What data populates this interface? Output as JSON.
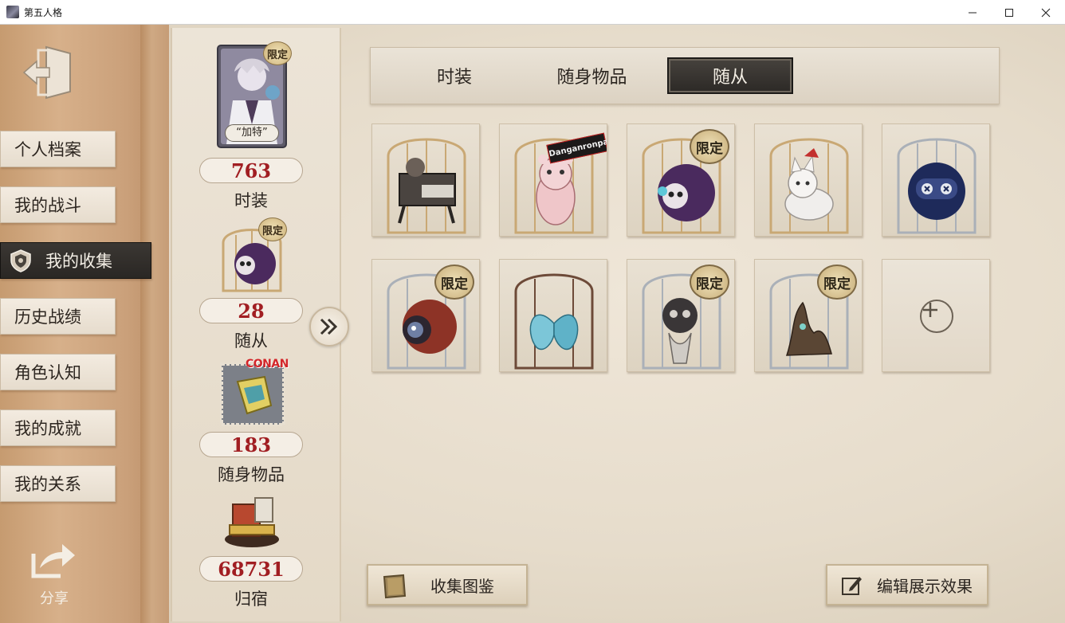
{
  "window": {
    "title": "第五人格"
  },
  "sidebar": {
    "items": [
      {
        "label": "个人档案",
        "active": false
      },
      {
        "label": "我的战斗",
        "active": false
      },
      {
        "label": "我的收集",
        "active": true
      },
      {
        "label": "历史战绩",
        "active": false
      },
      {
        "label": "角色认知",
        "active": false
      },
      {
        "label": "我的成就",
        "active": false
      },
      {
        "label": "我的关系",
        "active": false
      }
    ],
    "share_label": "分享"
  },
  "stats": {
    "costume": {
      "badge": "限定",
      "card_name": "“加特”",
      "value": "763",
      "label": "时装"
    },
    "companion": {
      "badge": "限定",
      "value": "28",
      "label": "随从"
    },
    "accessory": {
      "badge": "CONAN",
      "value": "183",
      "label": "随身物品"
    },
    "home": {
      "value": "68731",
      "label": "归宿"
    }
  },
  "tabs": [
    {
      "label": "时装",
      "active": false
    },
    {
      "label": "随身物品",
      "active": false
    },
    {
      "label": "随从",
      "active": true
    }
  ],
  "companions": [
    {
      "icon": "mechanical-beetle-companion",
      "limited": false,
      "badge": ""
    },
    {
      "icon": "danganronpa-bear-companion",
      "limited": false,
      "badge": "Danganronpa"
    },
    {
      "icon": "purple-sheep-companion",
      "limited": true,
      "badge": "限定"
    },
    {
      "icon": "white-fox-companion",
      "limited": false,
      "badge": ""
    },
    {
      "icon": "blue-robot-ball-companion",
      "limited": false,
      "badge": ""
    },
    {
      "icon": "red-eyeball-companion",
      "limited": true,
      "badge": "限定"
    },
    {
      "icon": "blue-butterfly-companion",
      "limited": false,
      "badge": ""
    },
    {
      "icon": "skull-creature-companion",
      "limited": true,
      "badge": "限定"
    },
    {
      "icon": "wooden-creature-companion",
      "limited": true,
      "badge": "限定"
    },
    {
      "icon": "add-icon",
      "limited": false,
      "badge": ""
    }
  ],
  "buttons": {
    "gallery": "收集图鉴",
    "edit_display": "编辑展示效果"
  },
  "colors": {
    "accent_red": "#a11e22",
    "active_tab": "#2c2926",
    "sidebar": "#d7b08a"
  }
}
